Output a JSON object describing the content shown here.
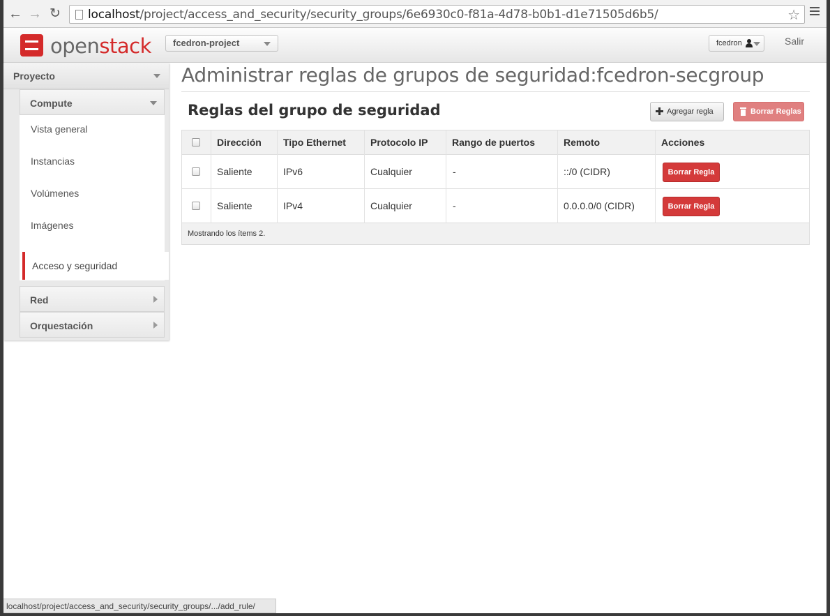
{
  "browser": {
    "url_host": "localhost",
    "url_path": "/project/access_and_security/security_groups/6e6930c0-f81a-4d78-b0b1-d1e71505d6b5/",
    "status_url": "localhost/project/access_and_security/security_groups/.../add_rule/"
  },
  "header": {
    "logo_part1": "open",
    "logo_part2": "stack",
    "project": "fcedron-project",
    "user": "fcedron",
    "logout": "Salir"
  },
  "sidebar": {
    "dashboard": "Proyecto",
    "panels": [
      {
        "label": "Compute"
      },
      {
        "label": "Red"
      },
      {
        "label": "Orquestación"
      }
    ],
    "items": [
      {
        "label": "Vista general"
      },
      {
        "label": "Instancias"
      },
      {
        "label": "Volúmenes"
      },
      {
        "label": "Imágenes"
      },
      {
        "label": "Acceso y seguridad",
        "active": true
      }
    ]
  },
  "main": {
    "title": "Administrar reglas de grupos de seguridad:fcedron-secgroup",
    "table_title": "Reglas del grupo de seguridad",
    "add_rule": "Agregar regla",
    "delete_rules": "Borrar Reglas",
    "columns": [
      "Dirección",
      "Tipo Ethernet",
      "Protocolo IP",
      "Rango de puertos",
      "Remoto",
      "Acciones"
    ],
    "rows": [
      {
        "direction": "Saliente",
        "ethertype": "IPv6",
        "protocol": "Cualquier",
        "ports": "-",
        "remote": "::/0 (CIDR)",
        "action": "Borrar Regla"
      },
      {
        "direction": "Saliente",
        "ethertype": "IPv4",
        "protocol": "Cualquier",
        "ports": "-",
        "remote": "0.0.0.0/0 (CIDR)",
        "action": "Borrar Regla"
      }
    ],
    "footer": "Mostrando los ítems 2."
  },
  "colors": {
    "brand_red": "#d42a2a",
    "danger_button": "#d43a3a",
    "danger_button_disabled": "#e08080"
  }
}
